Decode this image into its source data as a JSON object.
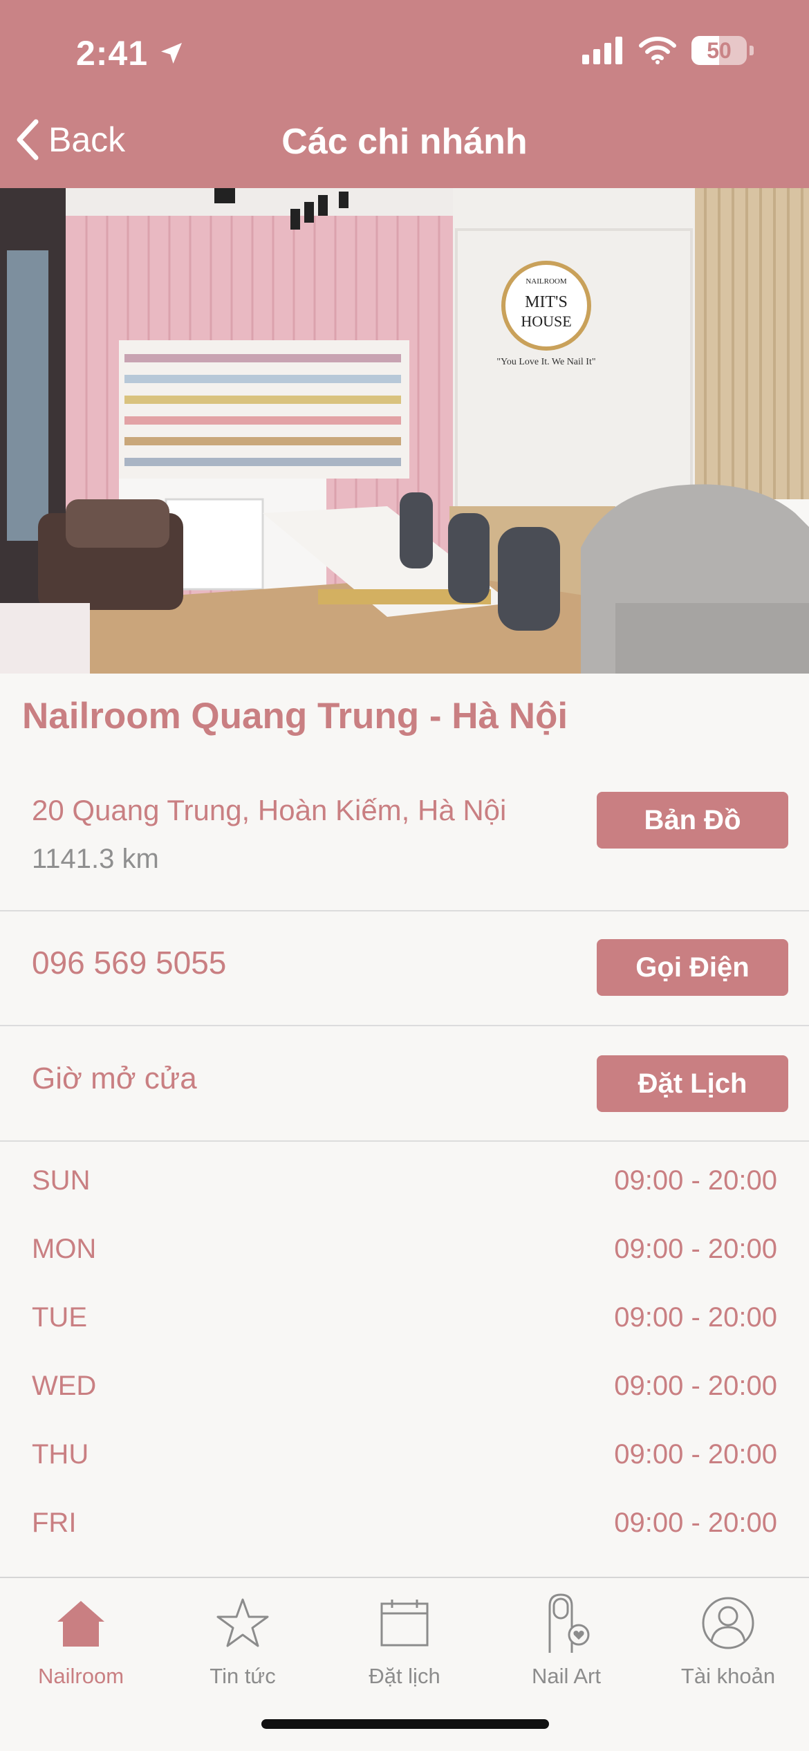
{
  "status_bar": {
    "time": "2:41",
    "battery_level": "50",
    "battery_fraction": 0.5
  },
  "nav": {
    "back_label": "Back",
    "title": "Các chi nhánh"
  },
  "branch": {
    "name": "Nailroom Quang Trung - Hà Nội",
    "address": "20 Quang Trung, Hoàn Kiếm, Hà Nội",
    "distance": "1141.3 km",
    "phone": "096 569 5055",
    "hours_label": "Giờ mở cửa",
    "map_button": "Bản Đồ",
    "call_button": "Gọi Điện",
    "book_button": "Đặt Lịch"
  },
  "hours": [
    {
      "day": "SUN",
      "time": "09:00 - 20:00"
    },
    {
      "day": "MON",
      "time": "09:00 - 20:00"
    },
    {
      "day": "TUE",
      "time": "09:00 - 20:00"
    },
    {
      "day": "WED",
      "time": "09:00 - 20:00"
    },
    {
      "day": "THU",
      "time": "09:00 - 20:00"
    },
    {
      "day": "FRI",
      "time": "09:00 - 20:00"
    }
  ],
  "hero_image": {
    "logo_line1": "NAILROOM",
    "logo_line2": "MIT'S",
    "logo_line3": "HOUSE",
    "slogan": "\"You Love It. We Nail It\""
  },
  "tabs": [
    {
      "label": "Nailroom",
      "icon": "home-icon",
      "active": true
    },
    {
      "label": "Tin tức",
      "icon": "star-icon",
      "active": false
    },
    {
      "label": "Đặt lịch",
      "icon": "calendar-icon",
      "active": false
    },
    {
      "label": "Nail Art",
      "icon": "nail-icon",
      "active": false
    },
    {
      "label": "Tài khoản",
      "icon": "account-icon",
      "active": false
    }
  ],
  "colors": {
    "accent": "#c97f82",
    "header": "#c98386",
    "background": "#f8f7f5",
    "muted": "#8c8c8c"
  }
}
